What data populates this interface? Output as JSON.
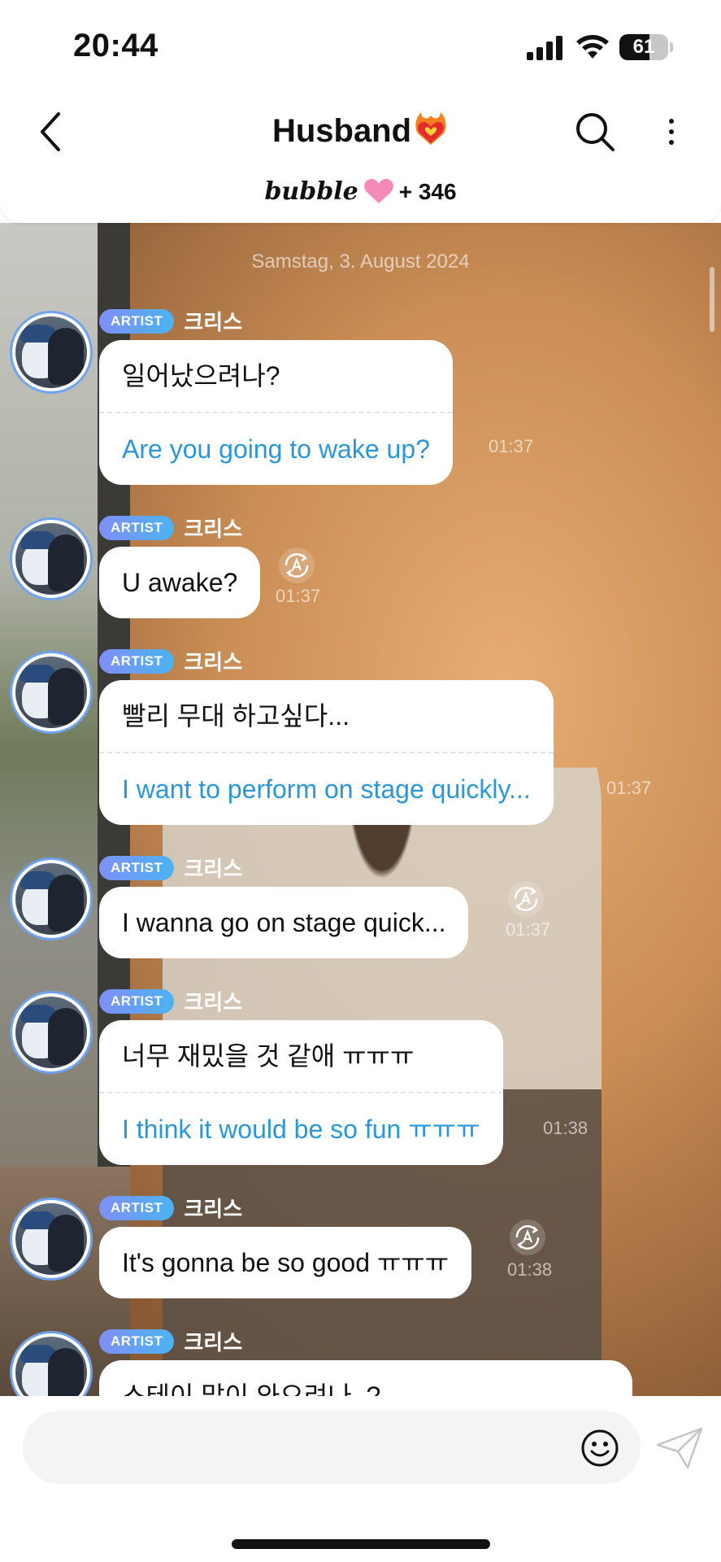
{
  "status_bar": {
    "time": "20:44",
    "battery_percent": "61",
    "battery_level": 0.61
  },
  "header": {
    "title": "Husband",
    "title_emoji": "heart-on-fire-emoji",
    "brand": "bubble",
    "brand_suffix": "+ 346"
  },
  "chat": {
    "date": "Samstag, 3. August 2024",
    "messages": [
      {
        "badge": "ARTIST",
        "sender": "크리스",
        "text": "일어났으려나?",
        "translation": "Are you going to wake up?",
        "time": "01:37",
        "translate_icon": false
      },
      {
        "badge": "ARTIST",
        "sender": "크리스",
        "text": "U awake?",
        "translation": "",
        "time": "01:37",
        "translate_icon": true
      },
      {
        "badge": "ARTIST",
        "sender": "크리스",
        "text": "빨리 무대 하고싶다...",
        "translation": "I want to perform on stage quickly...",
        "time": "01:37",
        "translate_icon": false
      },
      {
        "badge": "ARTIST",
        "sender": "크리스",
        "text": "I wanna go on stage quick...",
        "translation": "",
        "time": "01:37",
        "translate_icon": true
      },
      {
        "badge": "ARTIST",
        "sender": "크리스",
        "text": "너무 재밌을 것 같애 ㅠㅠㅠ",
        "translation": "I think it would be so fun ㅠㅠㅠ",
        "time": "01:38",
        "translate_icon": false
      },
      {
        "badge": "ARTIST",
        "sender": "크리스",
        "text": "It's gonna be so good ㅠㅠㅠ",
        "translation": "",
        "time": "01:38",
        "translate_icon": true
      },
      {
        "badge": "ARTIST",
        "sender": "크리스",
        "text": "스테이 많이 와으려나..?",
        "translation": "",
        "time": "",
        "translate_icon": false
      }
    ]
  },
  "input": {
    "placeholder": ""
  },
  "colors": {
    "accent_blue": "#2a97d8",
    "badge_start": "#7f8ff7",
    "badge_end": "#4bb3f1",
    "avatar_ring": "#6fa2f0"
  }
}
